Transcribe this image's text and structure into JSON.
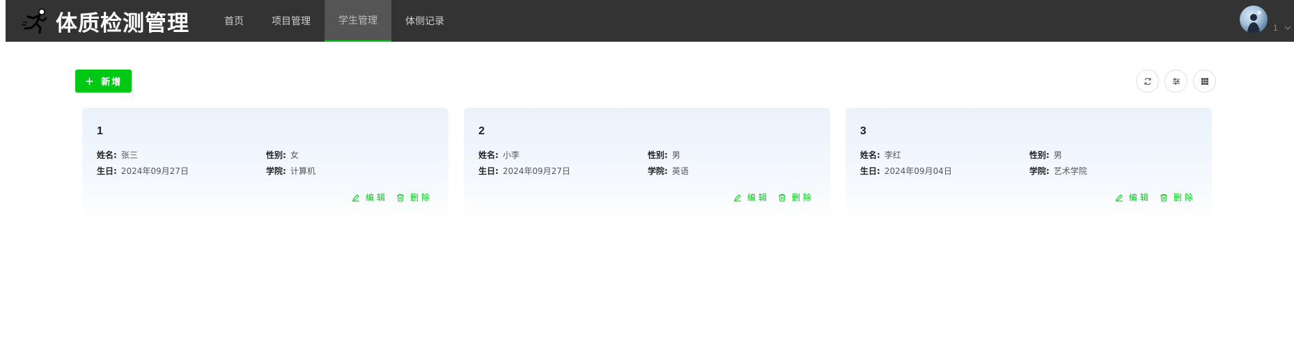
{
  "header": {
    "title": "体质检测管理",
    "nav": [
      {
        "label": "首页",
        "active": false
      },
      {
        "label": "项目管理",
        "active": false
      },
      {
        "label": "学生管理",
        "active": true
      },
      {
        "label": "体侧记录",
        "active": false
      }
    ],
    "user_name": "1"
  },
  "toolbar": {
    "add_label": "新增",
    "icons": [
      "refresh-icon",
      "filter-settings-icon",
      "grid-icon"
    ]
  },
  "labels": {
    "name": "姓名:",
    "gender": "性别:",
    "birthday": "生日:",
    "college": "学院:",
    "edit": "编辑",
    "delete": "删除"
  },
  "colors": {
    "accent": "#00c814",
    "header_bg": "#333333",
    "active_tab_bg": "#555555"
  },
  "cards": [
    {
      "id": "1",
      "name": "张三",
      "gender": "女",
      "birthday": "2024年09月27日",
      "college": "计算机"
    },
    {
      "id": "2",
      "name": "小李",
      "gender": "男",
      "birthday": "2024年09月27日",
      "college": "英语"
    },
    {
      "id": "3",
      "name": "李红",
      "gender": "男",
      "birthday": "2024年09月04日",
      "college": "艺术学院"
    }
  ]
}
